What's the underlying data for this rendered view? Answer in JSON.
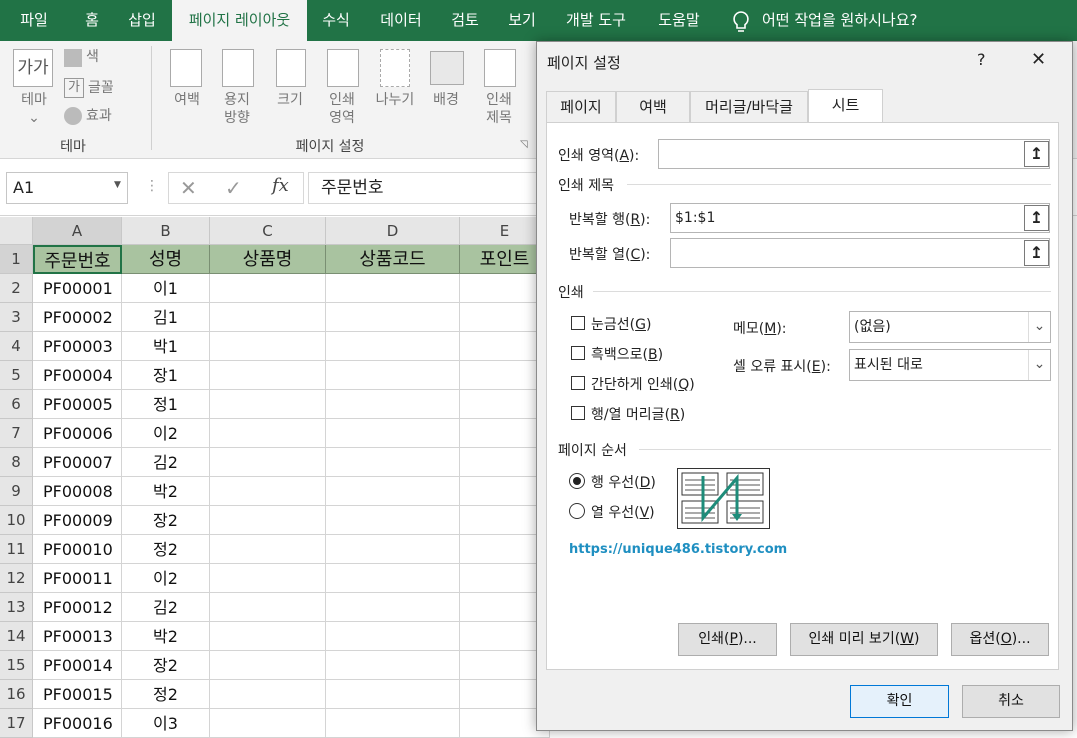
{
  "ribbon_tabs": [
    "파일",
    "홈",
    "삽입",
    "페이지 레이아웃",
    "수식",
    "데이터",
    "검토",
    "보기",
    "개발 도구",
    "도움말"
  ],
  "tell_me": "어떤 작업을 원하시나요?",
  "ribbon": {
    "theme_btn": "테마",
    "colors": "색",
    "fonts": "글꼴",
    "effects": "효과",
    "group_theme": "테마",
    "margins": "여백",
    "orientation_1": "용지",
    "orientation_2": "방향",
    "size": "크기",
    "print_area_1": "인쇄",
    "print_area_2": "영역",
    "breaks": "나누기",
    "background": "배경",
    "print_titles_1": "인쇄",
    "print_titles_2": "제목",
    "group_page_setup": "페이지 설정"
  },
  "name_box": "A1",
  "fx": "fx",
  "formula_value": "주문번호",
  "columns": [
    "A",
    "B",
    "C",
    "D",
    "E"
  ],
  "header_row": [
    "주문번호",
    "성명",
    "상품명",
    "상품코드",
    "포인트"
  ],
  "rows": [
    [
      "1"
    ],
    [
      "2",
      "PF00001",
      "이1"
    ],
    [
      "3",
      "PF00002",
      "김1"
    ],
    [
      "4",
      "PF00003",
      "박1"
    ],
    [
      "5",
      "PF00004",
      "장1"
    ],
    [
      "6",
      "PF00005",
      "정1"
    ],
    [
      "7",
      "PF00006",
      "이2"
    ],
    [
      "8",
      "PF00007",
      "김2"
    ],
    [
      "9",
      "PF00008",
      "박2"
    ],
    [
      "10",
      "PF00009",
      "장2"
    ],
    [
      "11",
      "PF00010",
      "정2"
    ],
    [
      "12",
      "PF00011",
      "이2"
    ],
    [
      "13",
      "PF00012",
      "김2"
    ],
    [
      "14",
      "PF00013",
      "박2"
    ],
    [
      "15",
      "PF00014",
      "장2"
    ],
    [
      "16",
      "PF00015",
      "정2"
    ],
    [
      "17",
      "PF00016",
      "이3"
    ]
  ],
  "dialog": {
    "title": "페이지 설정",
    "help": "?",
    "close": "✕",
    "tabs": [
      "페이지",
      "여백",
      "머리글/바닥글",
      "시트"
    ],
    "print_area_label": "인쇄 영역(",
    "print_area_key": "A",
    "print_titles_section": "인쇄 제목",
    "repeat_rows_label": "반복할 행(",
    "repeat_rows_key": "R",
    "repeat_rows_value": "$1:$1",
    "repeat_cols_label": "반복할 열(",
    "repeat_cols_key": "C",
    "print_section": "인쇄",
    "gridlines": "눈금선(",
    "gridlines_key": "G",
    "bw": "흑백으로(",
    "bw_key": "B",
    "draft": "간단하게 인쇄(",
    "draft_key": "Q",
    "headings": "행/열 머리글(",
    "headings_key": "R",
    "comments_label": "메모(",
    "comments_key": "M",
    "comments_value": "(없음)",
    "errors_label": "셀 오류 표시(",
    "errors_key": "E",
    "errors_value": "표시된 대로",
    "page_order_section": "페이지 순서",
    "down_then_over": "행 우선(",
    "down_then_over_key": "D",
    "over_then_down": "열 우선(",
    "over_then_down_key": "V",
    "watermark": "https://unique486.tistory.com",
    "print_btn": "인쇄(",
    "print_btn_key": "P",
    "preview_btn": "인쇄 미리 보기(",
    "preview_btn_key": "W",
    "options_btn": "옵션(",
    "options_btn_key": "O",
    "ok": "확인",
    "cancel": "취소"
  },
  "colors": {
    "excel_green": "#217346",
    "header_fill": "#a9c3a0",
    "link": "#1f8fc1"
  }
}
